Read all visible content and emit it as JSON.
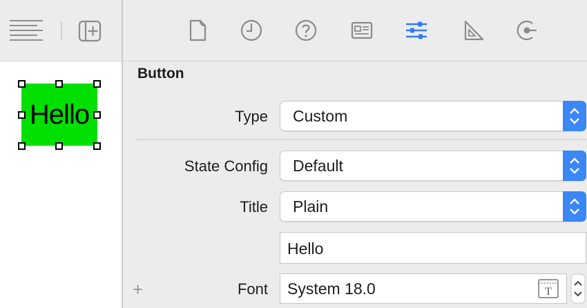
{
  "canvas": {
    "button_text": "Hello",
    "button_color": "#00e000",
    "toolbar_icons": [
      "document-outline-icon",
      "add-editor-icon"
    ]
  },
  "inspector": {
    "toolbar_icons": [
      "file-inspector-icon",
      "history-inspector-icon",
      "quick-help-icon",
      "identity-inspector-icon",
      "attributes-inspector-icon",
      "size-inspector-icon",
      "connections-inspector-icon"
    ],
    "selected_tab": "attributes-inspector-icon",
    "accent_color": "#2f7bf5",
    "section_title": "Button",
    "type": {
      "label": "Type",
      "value": "Custom"
    },
    "state_config": {
      "label": "State Config",
      "value": "Default"
    },
    "title": {
      "label": "Title",
      "value": "Plain",
      "text": "Hello"
    },
    "font": {
      "label": "Font",
      "value": "System 18.0"
    },
    "add_variation_label": "+"
  }
}
